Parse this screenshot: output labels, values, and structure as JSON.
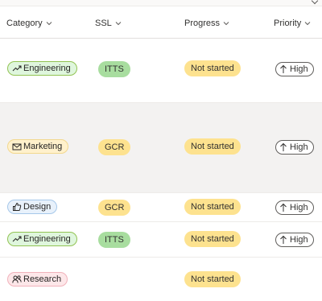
{
  "columns": [
    {
      "label": "Category"
    },
    {
      "label": "SSL"
    },
    {
      "label": "Progress"
    },
    {
      "label": "Priority"
    }
  ],
  "rows": [
    {
      "category": "Engineering",
      "category_icon": "trend-up-icon",
      "ssl": "ITTS",
      "ssl_color": "#a8dd9f",
      "progress": "Not started",
      "priority": "High"
    },
    {
      "category": "Marketing",
      "category_icon": "mail-icon",
      "ssl": "GCR",
      "ssl_color": "#fde28f",
      "progress": "Not started",
      "priority": "High"
    },
    {
      "category": "Design",
      "category_icon": "thumbs-up-icon",
      "ssl": "GCR",
      "ssl_color": "#fde28f",
      "progress": "Not started",
      "priority": "High"
    },
    {
      "category": "Engineering",
      "category_icon": "trend-up-icon",
      "ssl": "ITTS",
      "ssl_color": "#a8dd9f",
      "progress": "Not started",
      "priority": "High"
    },
    {
      "category": "Research",
      "category_icon": "people-icon",
      "ssl": "",
      "progress": "Not started",
      "priority": ""
    }
  ]
}
